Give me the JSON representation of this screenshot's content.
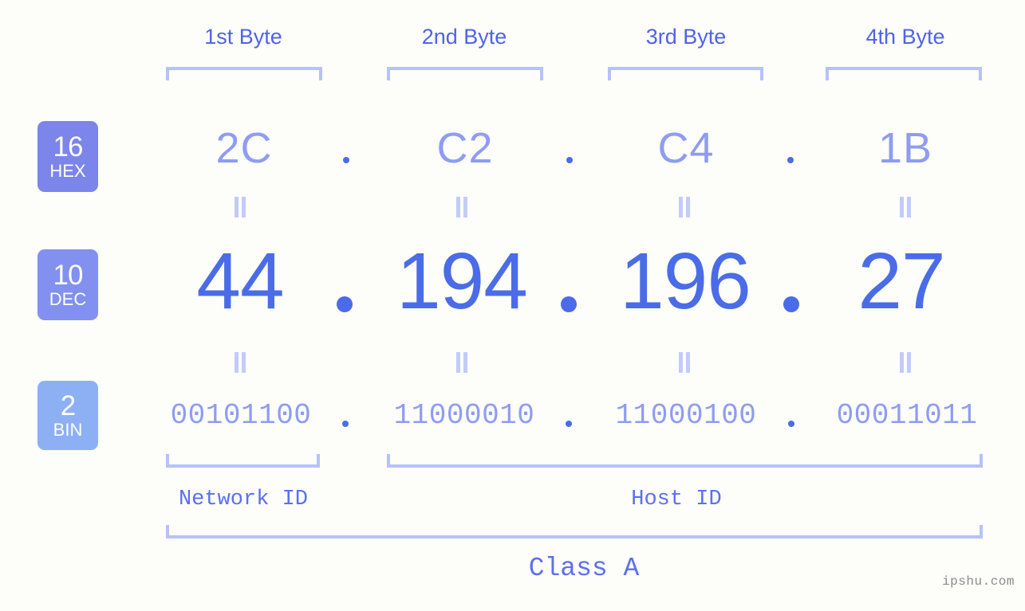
{
  "background_color": "#fdfdfa",
  "accent_colors": {
    "header_blue": "#4f63e8",
    "bracket_light": "#b7c1fb",
    "hex_value": "#8e9cf2",
    "dec_value": "#4a6ce8",
    "bin_value": "#8e9cf2",
    "badge_hex": "#7b85ea",
    "badge_dec": "#8290ef",
    "badge_bin": "#8db0f5",
    "equals_mark": "#c3cbfb",
    "watermark": "#8a8a8a"
  },
  "byte_headers": [
    {
      "label": "1st Byte"
    },
    {
      "label": "2nd Byte"
    },
    {
      "label": "3rd Byte"
    },
    {
      "label": "4th Byte"
    }
  ],
  "bases": [
    {
      "number": "16",
      "name": "HEX"
    },
    {
      "number": "10",
      "name": "DEC"
    },
    {
      "number": "2",
      "name": "BIN"
    }
  ],
  "rows": {
    "hex": {
      "base_number": "16",
      "base_name": "HEX",
      "values": [
        "2C",
        "C2",
        "C4",
        "1B"
      ],
      "separator": "."
    },
    "dec": {
      "base_number": "10",
      "base_name": "DEC",
      "values": [
        "44",
        "194",
        "196",
        "27"
      ],
      "separator": "."
    },
    "bin": {
      "base_number": "2",
      "base_name": "BIN",
      "values": [
        "00101100",
        "11000010",
        "11000100",
        "00011011"
      ],
      "separator": "."
    }
  },
  "equals_marker": "||",
  "segments": {
    "network_id": "Network ID",
    "host_id": "Host ID",
    "class": "Class A"
  },
  "watermark": "ipshu.com"
}
